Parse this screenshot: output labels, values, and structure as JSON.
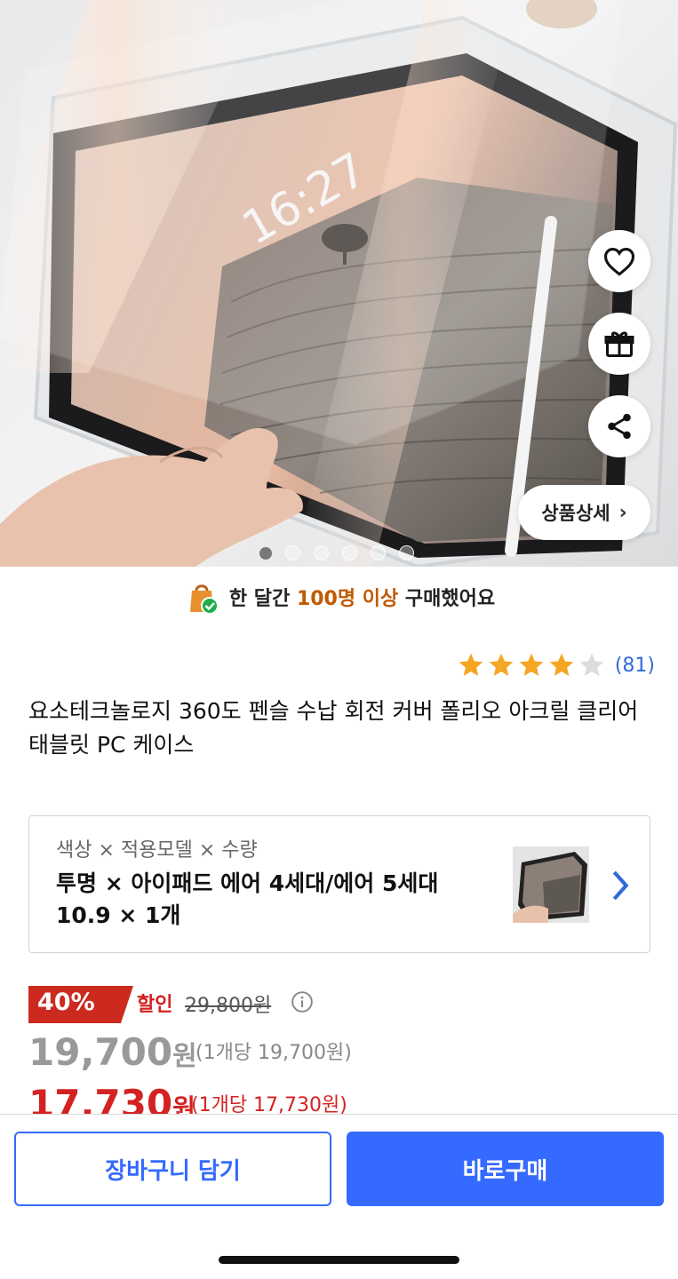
{
  "hero": {
    "screen_clock": "16:27",
    "detail_button_label": "상품상세",
    "dots_total": 6,
    "dots_active_index": 0
  },
  "banner": {
    "prefix": "한 달간",
    "highlight": "100명 이상",
    "suffix": "구매했어요"
  },
  "rating": {
    "stars": 4,
    "max_stars": 5,
    "count_label": "(81)"
  },
  "product": {
    "title": "요소테크놀로지 360도 펜슬 수납 회전 커버 폴리오 아크릴 클리어 태블릿 PC 케이스"
  },
  "option": {
    "label": "색상 × 적용모델 × 수량",
    "value": "투명 × 아이패드 에어 4세대/에어 5세대 10.9 × 1개"
  },
  "pricing": {
    "discount_rate": "40%",
    "discount_label": "할인",
    "original_price": "29,800원",
    "price": "19,700",
    "price_won": "원",
    "price_unit": "(1개당 19,700원)",
    "sale_price": "17,730",
    "sale_price_won": "원",
    "sale_price_unit": "(1개당 17,730원)"
  },
  "actions": {
    "cart_label": "장바구니 담기",
    "buy_label": "바로구매"
  },
  "colors": {
    "brand_blue": "#346aff",
    "sale_red": "#d42222",
    "star": "#f5a623",
    "banner_highlight": "#c05a00"
  }
}
